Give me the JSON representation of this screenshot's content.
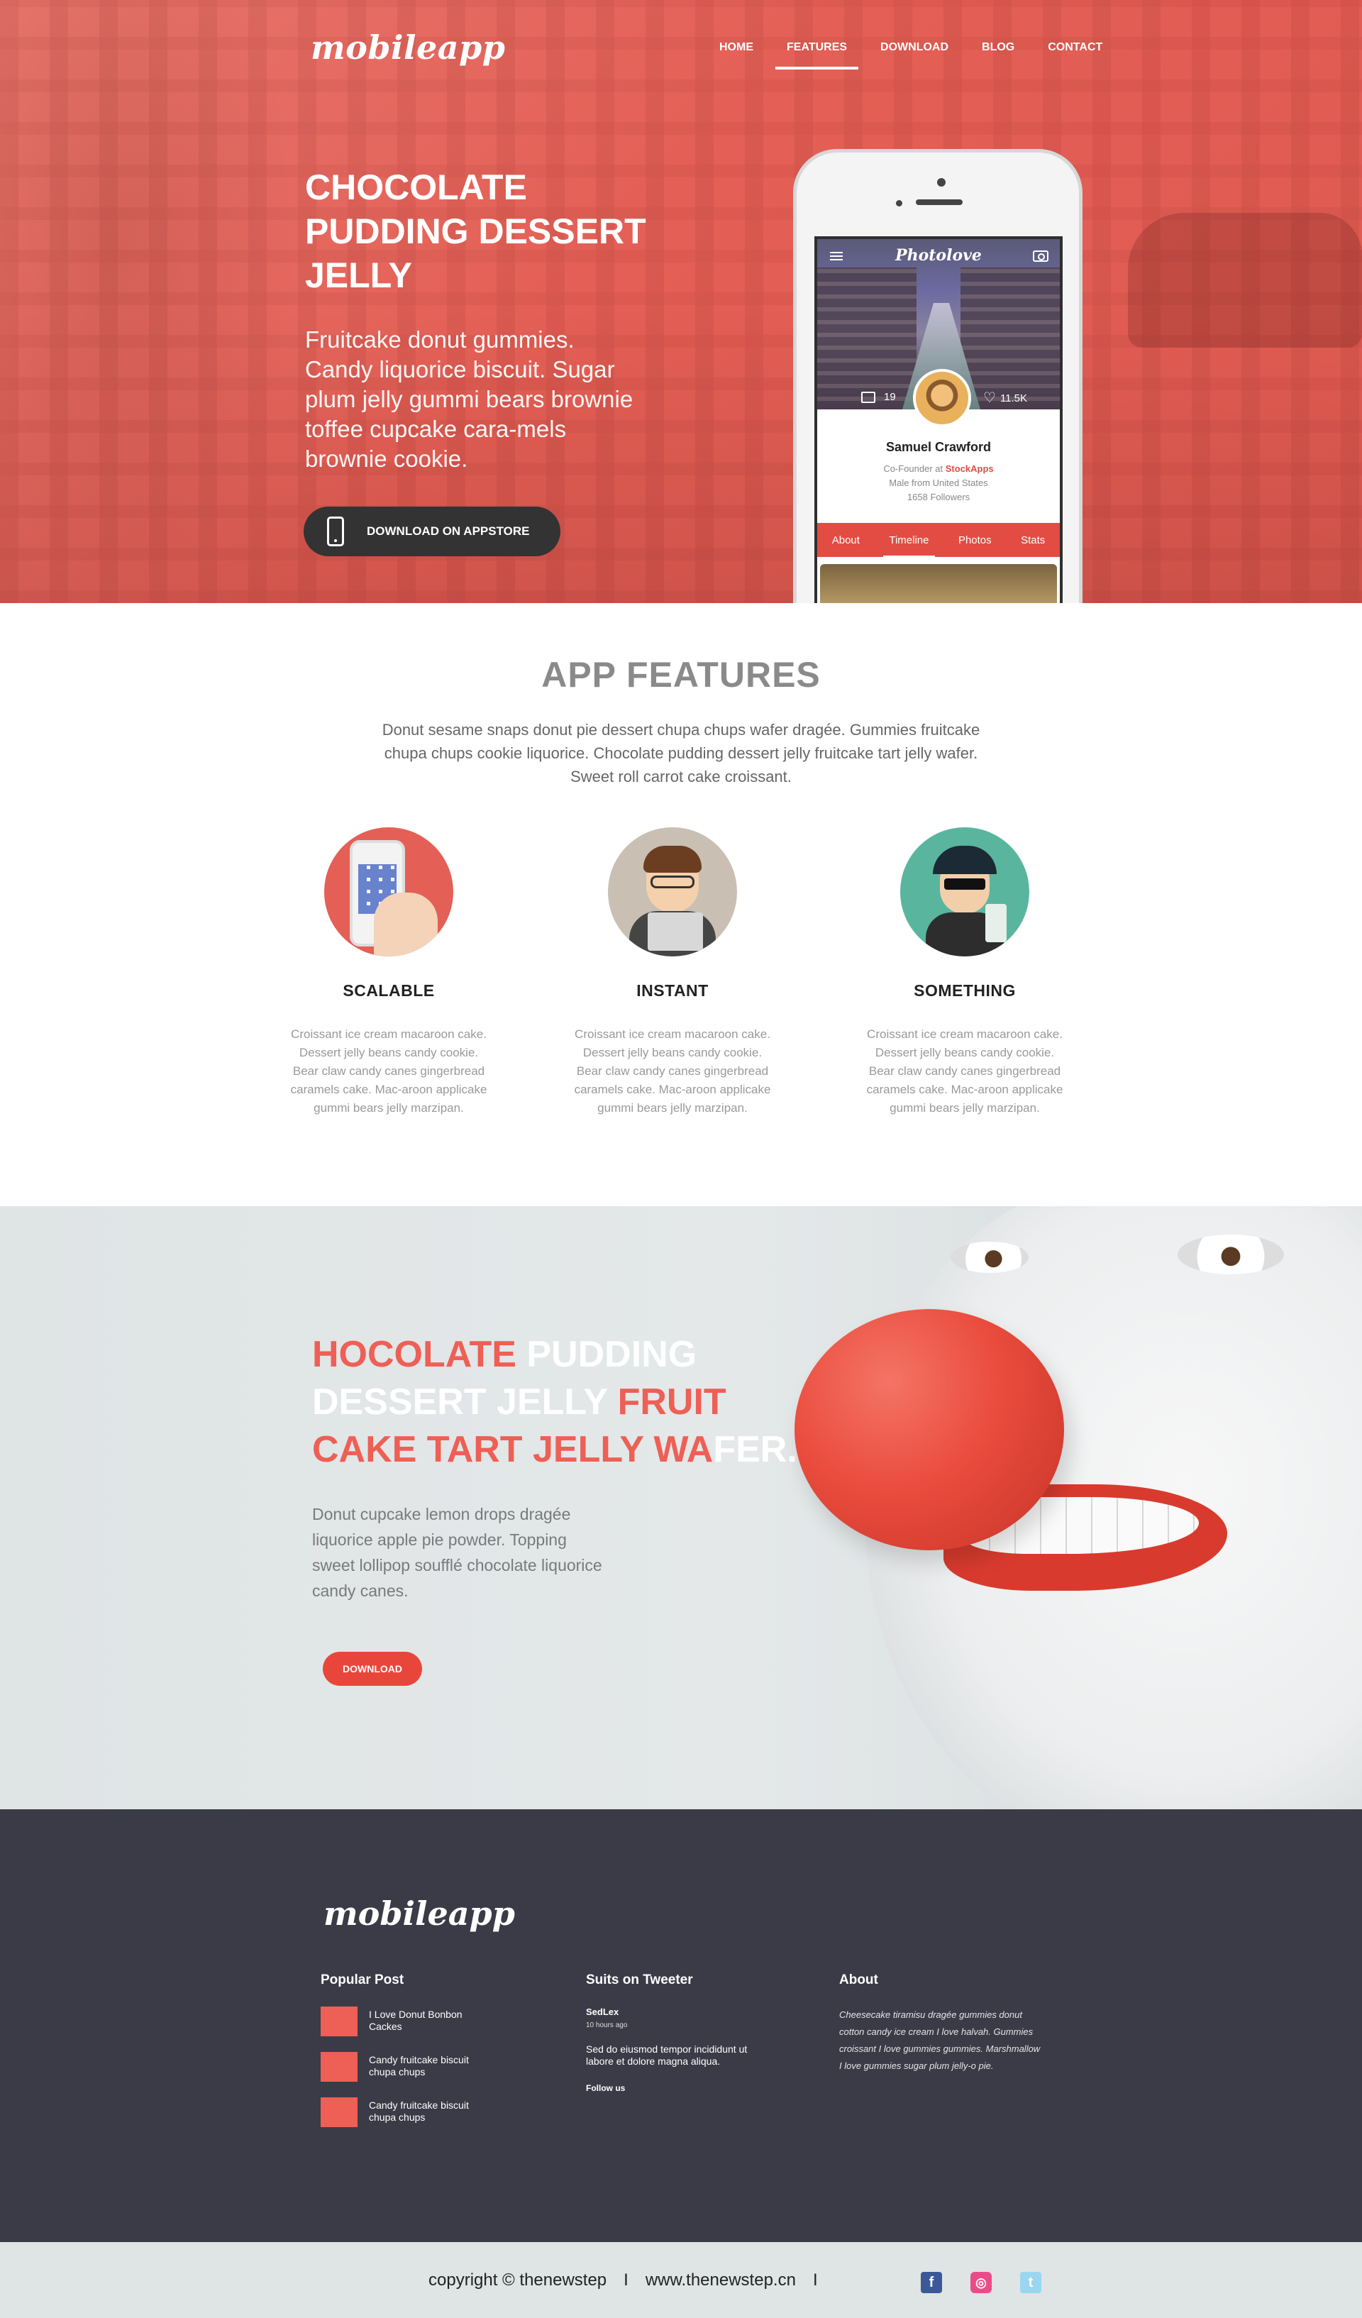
{
  "brand": {
    "logo": "mobileapp"
  },
  "nav": {
    "items": [
      "HOME",
      "FEATURES",
      "DOWNLOAD",
      "BLOG",
      "CONTACT"
    ],
    "active": "FEATURES"
  },
  "hero": {
    "title": "CHOCOLATE PUDDING DESSERT JELLY",
    "text": "Fruitcake donut gummies. Candy liquorice biscuit. Sugar plum jelly gummi bears brownie toffee cupcake cara-mels brownie cookie.",
    "button": "DOWNLOAD ON APPSTORE"
  },
  "phone_app": {
    "title": "Photolove",
    "photos_count": "19",
    "likes_count": "11.5K",
    "profile_name": "Samuel Crawford",
    "role_prefix": "Co-Founder at",
    "company": "StockApps",
    "location": "Male from United States",
    "followers": "1658 Followers",
    "tabs": [
      "About",
      "Timeline",
      "Photos",
      "Stats"
    ],
    "active_tab": "Timeline"
  },
  "features": {
    "title": "APP FEATURES",
    "intro": "Donut sesame snaps donut pie dessert chupa chups wafer dragée. Gummies fruitcake chupa chups cookie liquorice. Chocolate pudding dessert jelly fruitcake tart jelly wafer. Sweet roll carrot cake croissant.",
    "items": [
      {
        "title": "SCALABLE",
        "icon": "phone-touch-illustration",
        "text": "Croissant ice cream macaroon cake. Dessert jelly beans candy cookie. Bear claw candy canes gingerbread caramels cake. Mac-aroon applicake gummi bears jelly marzipan."
      },
      {
        "title": "INSTANT",
        "icon": "developer-laptop-illustration",
        "text": "Croissant ice cream macaroon cake. Dessert jelly beans candy cookie. Bear claw candy canes gingerbread caramels cake. Mac-aroon applicake gummi bears jelly marzipan."
      },
      {
        "title": "SOMETHING",
        "icon": "cool-guy-illustration",
        "text": "Croissant ice cream macaroon cake. Dessert jelly beans candy cookie. Bear claw candy canes gingerbread caramels cake. Mac-aroon applicake gummi bears jelly marzipan."
      }
    ]
  },
  "promo": {
    "title_parts": [
      {
        "text": "HOCOLATE ",
        "color": "red"
      },
      {
        "text": "PUDDING DESSERT JELLY ",
        "color": "white"
      },
      {
        "text": "FRUIT CAKE TART JELLY WA",
        "color": "red"
      },
      {
        "text": "FER.",
        "color": "white"
      }
    ],
    "text": "Donut cupcake lemon drops dragée liquorice apple pie powder. Topping sweet lollipop soufflé chocolate liquorice candy canes.",
    "button": "DOWNLOAD"
  },
  "footer": {
    "logo": "mobileapp",
    "popular_post": {
      "heading": "Popular Post",
      "items": [
        "I Love Donut Bonbon Cackes",
        "Candy fruitcake biscuit chupa chups",
        "Candy fruitcake biscuit chupa chups"
      ]
    },
    "tweets": {
      "heading": "Suits on Tweeter",
      "user": "SedLex",
      "time": "10 hours ago",
      "body": "Sed do eiusmod tempor incididunt ut labore et dolore magna aliqua.",
      "follow": "Follow us"
    },
    "about": {
      "heading": "About",
      "text": "Cheesecake tiramisu dragée gummies donut cotton candy ice cream I love halvah. Gummies croissant I love gummies gummies. Marshmallow I love gummies sugar plum jelly-o pie."
    }
  },
  "bottom_bar": {
    "copyright": "copyright © thenewstep",
    "separator": "I",
    "website": "www.thenewstep.cn",
    "separator2": "I",
    "social": [
      "facebook-icon",
      "dribbble-icon",
      "twitter-icon"
    ]
  },
  "colors": {
    "accent": "#e45f55",
    "footer_bg": "#3b3b47",
    "dark_button": "#333333",
    "teal": "#5ab59f"
  }
}
